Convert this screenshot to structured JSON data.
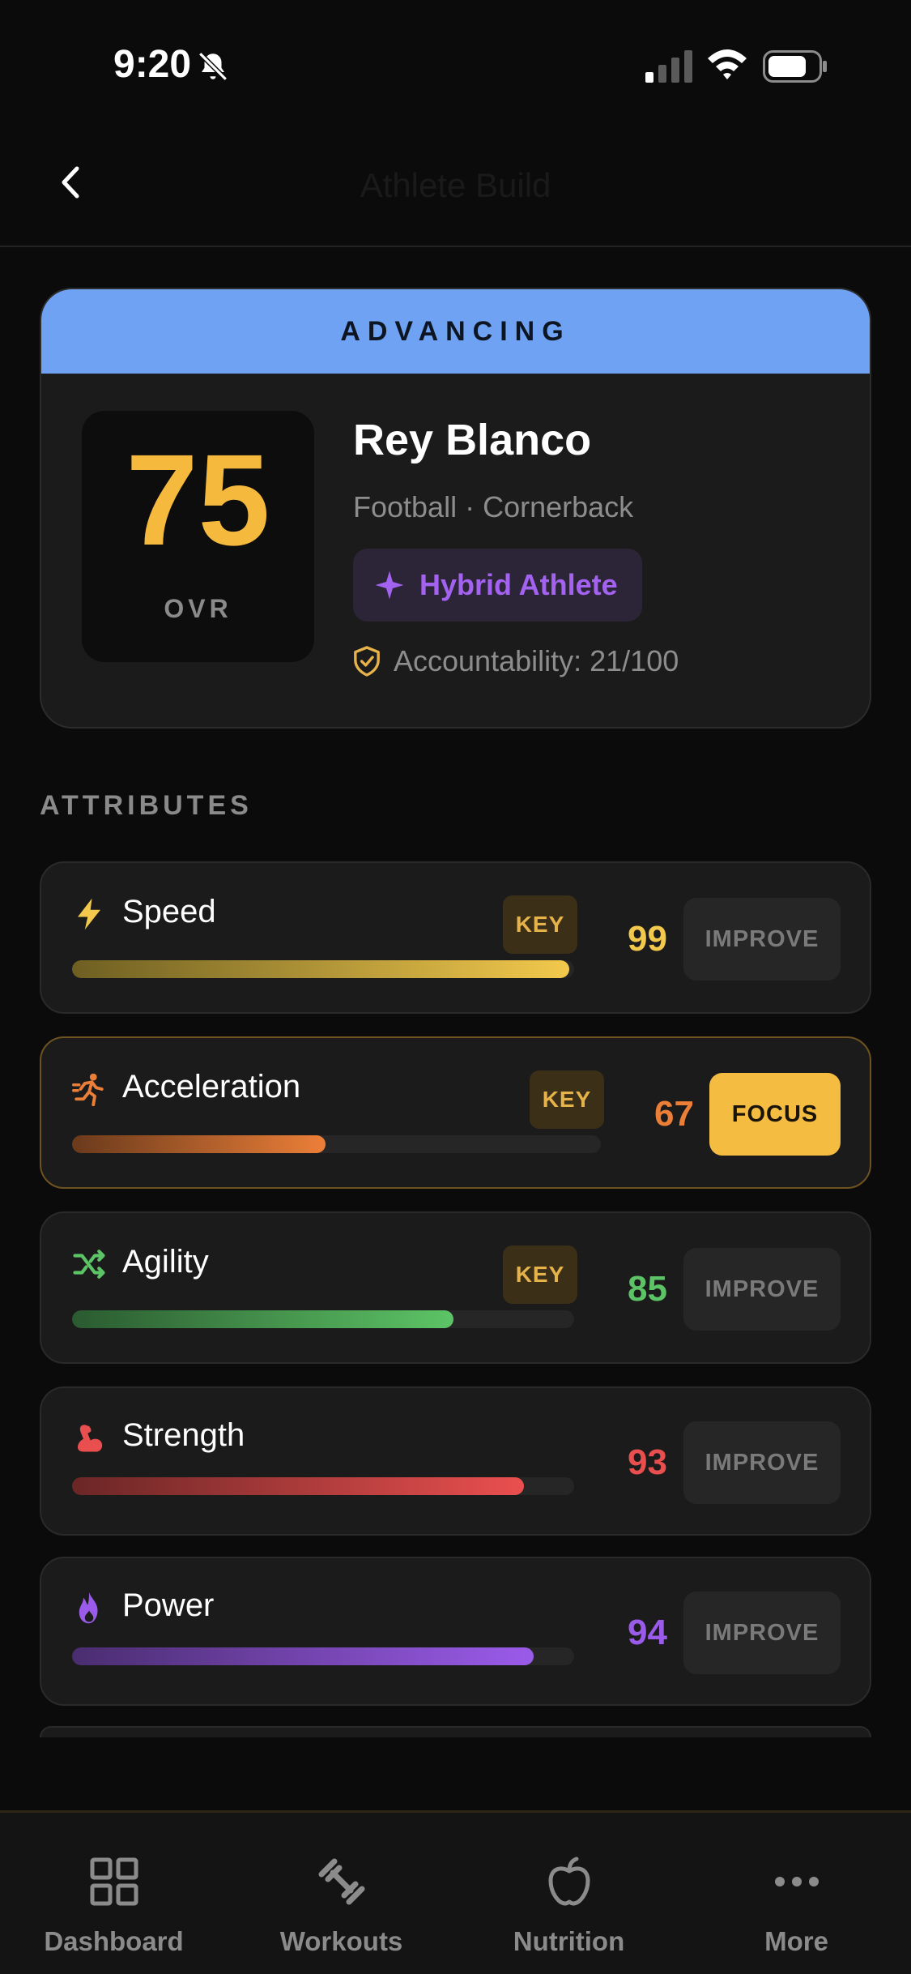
{
  "status_bar": {
    "time": "9:20"
  },
  "header": {
    "title": "Athlete Build",
    "back_icon": "chevron-left-icon"
  },
  "athlete": {
    "tier": "ADVANCING",
    "ovr_value": "75",
    "ovr_label": "OVR",
    "name": "Rey Blanco",
    "sport_position": "Football · Cornerback",
    "archetype": "Hybrid Athlete",
    "accountability": "Accountability: 21/100"
  },
  "attributes_title": "ATTRIBUTES",
  "attributes": [
    {
      "name": "Speed",
      "icon": "lightning-icon",
      "key": "KEY",
      "value": "99",
      "percent": 99,
      "action": "IMPROVE",
      "color": "#f2c94c",
      "color_dark": "#6e5f22"
    },
    {
      "name": "Acceleration",
      "icon": "running-icon",
      "key": "KEY",
      "value": "67",
      "percent": 48,
      "action": "FOCUS",
      "color": "#ec7f38",
      "color_dark": "#6a3a1c"
    },
    {
      "name": "Agility",
      "icon": "shuffle-icon",
      "key": "KEY",
      "value": "85",
      "percent": 76,
      "action": "IMPROVE",
      "color": "#5cc466",
      "color_dark": "#2b5a30"
    },
    {
      "name": "Strength",
      "icon": "muscle-icon",
      "value": "93",
      "percent": 90,
      "action": "IMPROVE",
      "color": "#ea4f4f",
      "color_dark": "#6b2626"
    },
    {
      "name": "Power",
      "icon": "flame-icon",
      "value": "94",
      "percent": 92,
      "action": "IMPROVE",
      "color": "#9b5bea",
      "color_dark": "#4a2d70"
    }
  ],
  "tabs": [
    {
      "label": "Dashboard",
      "icon": "grid-icon"
    },
    {
      "label": "Workouts",
      "icon": "dumbbell-icon"
    },
    {
      "label": "Nutrition",
      "icon": "apple-icon"
    },
    {
      "label": "More",
      "icon": "more-icon"
    }
  ]
}
